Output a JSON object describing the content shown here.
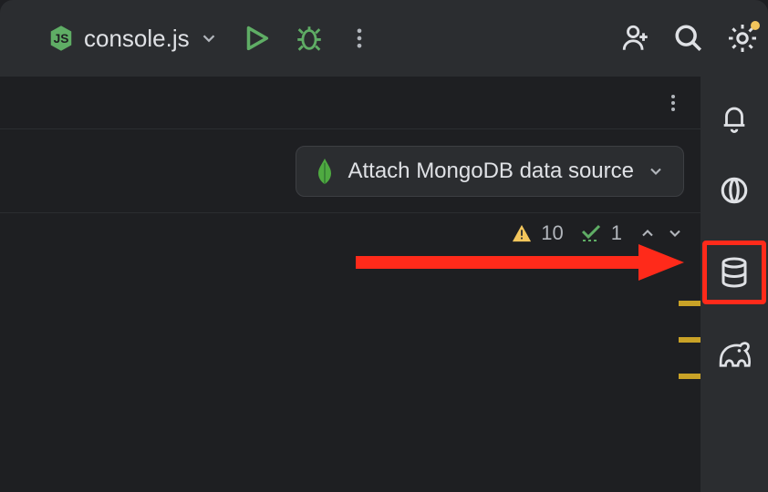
{
  "topbar": {
    "file_name": "console.js"
  },
  "pill": {
    "label": "Attach MongoDB data source"
  },
  "status": {
    "warnings": "10",
    "ok": "1"
  },
  "colors": {
    "green": "#5fad65",
    "annotation_red": "#ff2a1a",
    "warning_yellow": "#c9a227",
    "mongo_green": "#4faa41"
  }
}
